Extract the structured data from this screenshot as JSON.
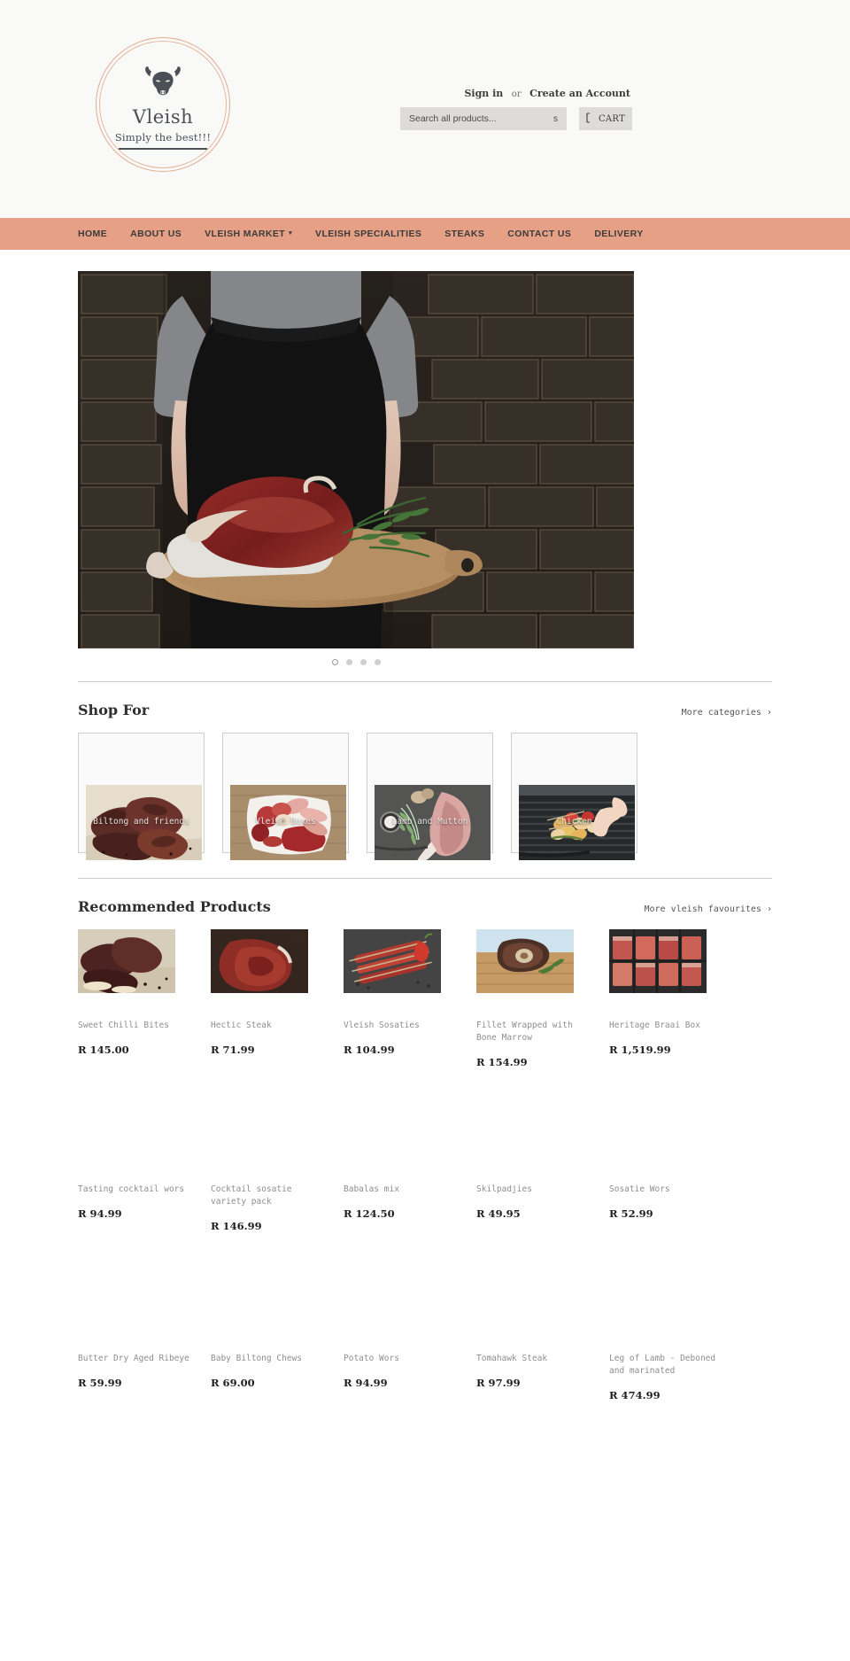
{
  "brand": {
    "name": "Vleish",
    "tagline": "Simply the best!!!",
    "logo_icon": "bull-head-icon",
    "accent_color": "#e6a085",
    "header_bg": "#f9f9f8"
  },
  "header": {
    "sign_in": "Sign in",
    "or": "or",
    "create_account": "Create an Account",
    "search_placeholder": "Search all products...",
    "search_value": "",
    "search_icon": "search-icon",
    "search_icon_glyph": "s",
    "cart_label": "CART",
    "cart_icon": "shopping-bag-icon"
  },
  "nav": {
    "items": [
      {
        "label": "HOME",
        "has_dropdown": false
      },
      {
        "label": "ABOUT US",
        "has_dropdown": false
      },
      {
        "label": "VLEISH MARKET",
        "has_dropdown": true
      },
      {
        "label": "VLEISH SPECIALITIES",
        "has_dropdown": false
      },
      {
        "label": "STEAKS",
        "has_dropdown": false
      },
      {
        "label": "CONTACT US",
        "has_dropdown": false
      },
      {
        "label": "DELIVERY",
        "has_dropdown": false
      }
    ]
  },
  "hero": {
    "alt": "Butcher in black apron holding wooden board with raw ribeye steak and rosemary against a dark brick wall",
    "slides": 4,
    "active_slide": 1
  },
  "shop_for": {
    "title": "Shop For",
    "more_link": "More categories ›",
    "categories": [
      {
        "label": "Biltong and friends"
      },
      {
        "label": "Vleish Boxes"
      },
      {
        "label": "Lamb and Mutton"
      },
      {
        "label": "Chicken"
      }
    ]
  },
  "recommended": {
    "title": "Recommended Products",
    "more_link": "More vleish favourites ›",
    "products": [
      {
        "name": "Sweet Chilli Bites",
        "price": "R 145.00",
        "has_image": true
      },
      {
        "name": "Hectic Steak",
        "price": "R 71.99",
        "has_image": true
      },
      {
        "name": "Vleish Sosaties",
        "price": "R 104.99",
        "has_image": true
      },
      {
        "name": "Fillet Wrapped with Bone Marrow",
        "price": "R 154.99",
        "has_image": true
      },
      {
        "name": "Heritage Braai Box",
        "price": "R 1,519.99",
        "has_image": true
      },
      {
        "name": "Tasting cocktail wors",
        "price": "R 94.99",
        "has_image": false
      },
      {
        "name": "Cocktail sosatie variety pack",
        "price": "R 146.99",
        "has_image": false
      },
      {
        "name": "Babalas mix",
        "price": "R 124.50",
        "has_image": false
      },
      {
        "name": "Skilpadjies",
        "price": "R 49.95",
        "has_image": false
      },
      {
        "name": "Sosatie Wors",
        "price": "R 52.99",
        "has_image": false
      },
      {
        "name": "Butter Dry Aged Ribeye",
        "price": "R 59.99",
        "has_image": false
      },
      {
        "name": "Baby Biltong Chews",
        "price": "R 69.00",
        "has_image": false
      },
      {
        "name": "Potato Wors",
        "price": "R 94.99",
        "has_image": false
      },
      {
        "name": "Tomahawk Steak",
        "price": "R 97.99",
        "has_image": false
      },
      {
        "name": "Leg of Lamb - Deboned and marinated",
        "price": "R 474.99",
        "has_image": false
      }
    ]
  }
}
